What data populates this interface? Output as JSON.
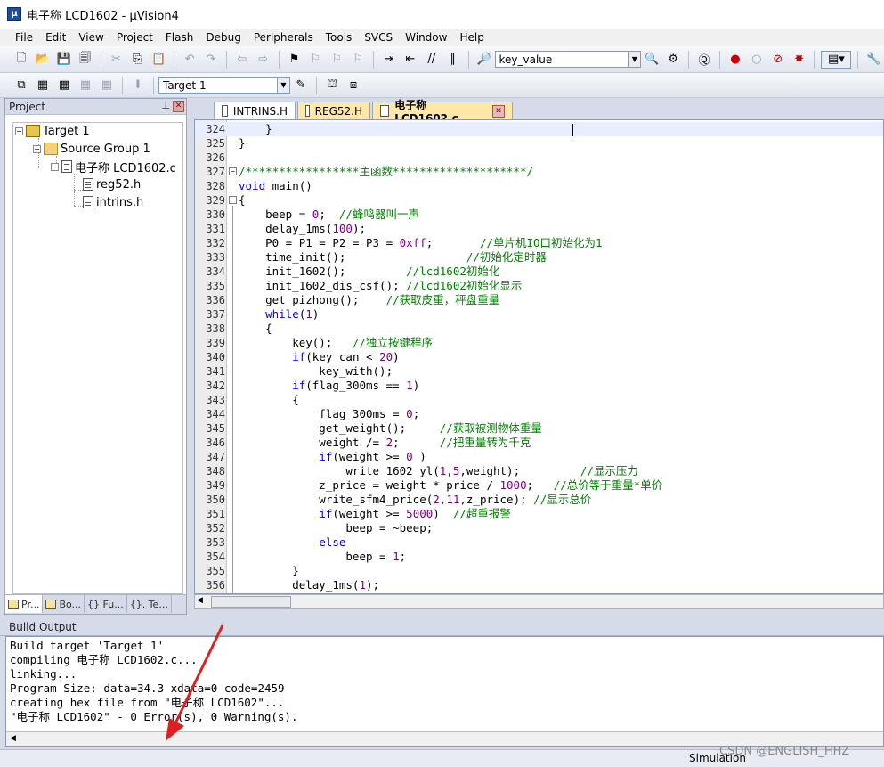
{
  "window": {
    "title": "电子称 LCD1602 - µVision4"
  },
  "menu": [
    "File",
    "Edit",
    "View",
    "Project",
    "Flash",
    "Debug",
    "Peripherals",
    "Tools",
    "SVCS",
    "Window",
    "Help"
  ],
  "toolbar": {
    "find_value": "key_value",
    "target_value": "Target 1"
  },
  "project_panel": {
    "title": "Project",
    "tree": {
      "target": "Target 1",
      "group": "Source Group 1",
      "file": "电子称 LCD1602.c",
      "children": [
        "reg52.h",
        "intrins.h"
      ]
    },
    "tabs": [
      "Pr...",
      "Bo...",
      "{} Fu...",
      "{}. Te..."
    ]
  },
  "editor": {
    "tabs": [
      {
        "label": "INTRINS.H"
      },
      {
        "label": "REG52.H"
      },
      {
        "label": "电子称 LCD1602.c"
      }
    ],
    "lines": [
      {
        "n": "324",
        "code": "    }"
      },
      {
        "n": "325",
        "code": "}"
      },
      {
        "n": "326",
        "code": ""
      },
      {
        "n": "327",
        "code": "/*****************主函数********************/"
      },
      {
        "n": "328",
        "code": "void main()"
      },
      {
        "n": "329",
        "code": "{"
      },
      {
        "n": "330",
        "code": "    beep = 0;  //蜂鸣器叫一声"
      },
      {
        "n": "331",
        "code": "    delay_1ms(100);"
      },
      {
        "n": "332",
        "code": "    P0 = P1 = P2 = P3 = 0xff;       //单片机IO口初始化为1"
      },
      {
        "n": "333",
        "code": "    time_init();                  //初始化定时器"
      },
      {
        "n": "334",
        "code": "    init_1602();         //lcd1602初始化"
      },
      {
        "n": "335",
        "code": "    init_1602_dis_csf(); //lcd1602初始化显示"
      },
      {
        "n": "336",
        "code": "    get_pizhong();    //获取皮重，秤盘重量"
      },
      {
        "n": "337",
        "code": "    while(1)"
      },
      {
        "n": "338",
        "code": "    {"
      },
      {
        "n": "339",
        "code": "        key();   //独立按键程序"
      },
      {
        "n": "340",
        "code": "        if(key_can < 20)"
      },
      {
        "n": "341",
        "code": "            key_with();"
      },
      {
        "n": "342",
        "code": "        if(flag_300ms == 1)"
      },
      {
        "n": "343",
        "code": "        {"
      },
      {
        "n": "344",
        "code": "            flag_300ms = 0;"
      },
      {
        "n": "345",
        "code": "            get_weight();     //获取被测物体重量"
      },
      {
        "n": "346",
        "code": "            weight /= 2;      //把重量转为千克"
      },
      {
        "n": "347",
        "code": "            if(weight >= 0 )"
      },
      {
        "n": "348",
        "code": "                write_1602_yl(1,5,weight);         //显示压力"
      },
      {
        "n": "349",
        "code": "            z_price = weight * price / 1000;   //总价等于重量*单价"
      },
      {
        "n": "350",
        "code": "            write_sfm4_price(2,11,z_price); //显示总价"
      },
      {
        "n": "351",
        "code": "            if(weight >= 5000)  //超重报警"
      },
      {
        "n": "352",
        "code": "                beep = ~beep;"
      },
      {
        "n": "353",
        "code": "            else"
      },
      {
        "n": "354",
        "code": "                beep = 1;"
      },
      {
        "n": "355",
        "code": "        }"
      },
      {
        "n": "356",
        "code": "        delay_1ms(1);"
      }
    ]
  },
  "build_output": {
    "title": "Build Output",
    "lines": [
      "Build target 'Target 1'",
      "compiling 电子称 LCD1602.c...",
      "linking...",
      "Program Size: data=34.3 xdata=0 code=2459",
      "creating hex file from \"电子称 LCD1602\"...",
      "\"电子称 LCD1602\" - 0 Error(s), 0 Warning(s)."
    ]
  },
  "status": {
    "mode": "Simulation"
  },
  "watermark": "CSDN @ENGLISH_HHZ",
  "colors": {
    "keyword": "#0000ff",
    "comment": "#008000",
    "number": "#800080",
    "annotation_arrow": "#e02020"
  }
}
